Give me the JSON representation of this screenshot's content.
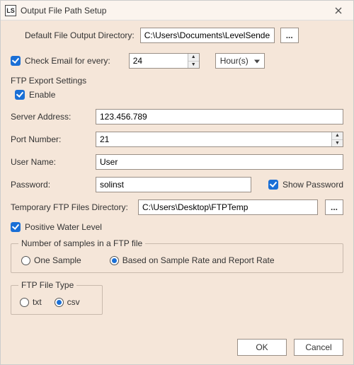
{
  "window": {
    "icon_text": "LS",
    "title": "Output File Path Setup"
  },
  "defaultDir": {
    "label": "Default File Output Directory:",
    "value": "C:\\Users\\Documents\\LevelSender\\d",
    "browse": "..."
  },
  "checkEmail": {
    "label": "Check Email for every:",
    "value": "24",
    "unit_selected": "Hour(s)"
  },
  "ftp": {
    "heading": "FTP Export Settings",
    "enable_label": "Enable",
    "server": {
      "label": "Server Address:",
      "value": "123.456.789"
    },
    "port": {
      "label": "Port Number:",
      "value": "21"
    },
    "user": {
      "label": "User Name:",
      "value": "User"
    },
    "pass": {
      "label": "Password:",
      "value": "solinst"
    },
    "show_pass_label": "Show Password",
    "tempdir": {
      "label": "Temporary FTP Files Directory:",
      "value": "C:\\Users\\Desktop\\FTPTemp",
      "browse": "..."
    }
  },
  "positiveWater": {
    "label": "Positive Water Level"
  },
  "samples": {
    "legend": "Number of samples in a FTP file",
    "one_label": "One Sample",
    "rate_label": "Based on Sample Rate and Report Rate"
  },
  "filetype": {
    "legend": "FTP File Type",
    "txt_label": "txt",
    "csv_label": "csv"
  },
  "buttons": {
    "ok": "OK",
    "cancel": "Cancel"
  }
}
